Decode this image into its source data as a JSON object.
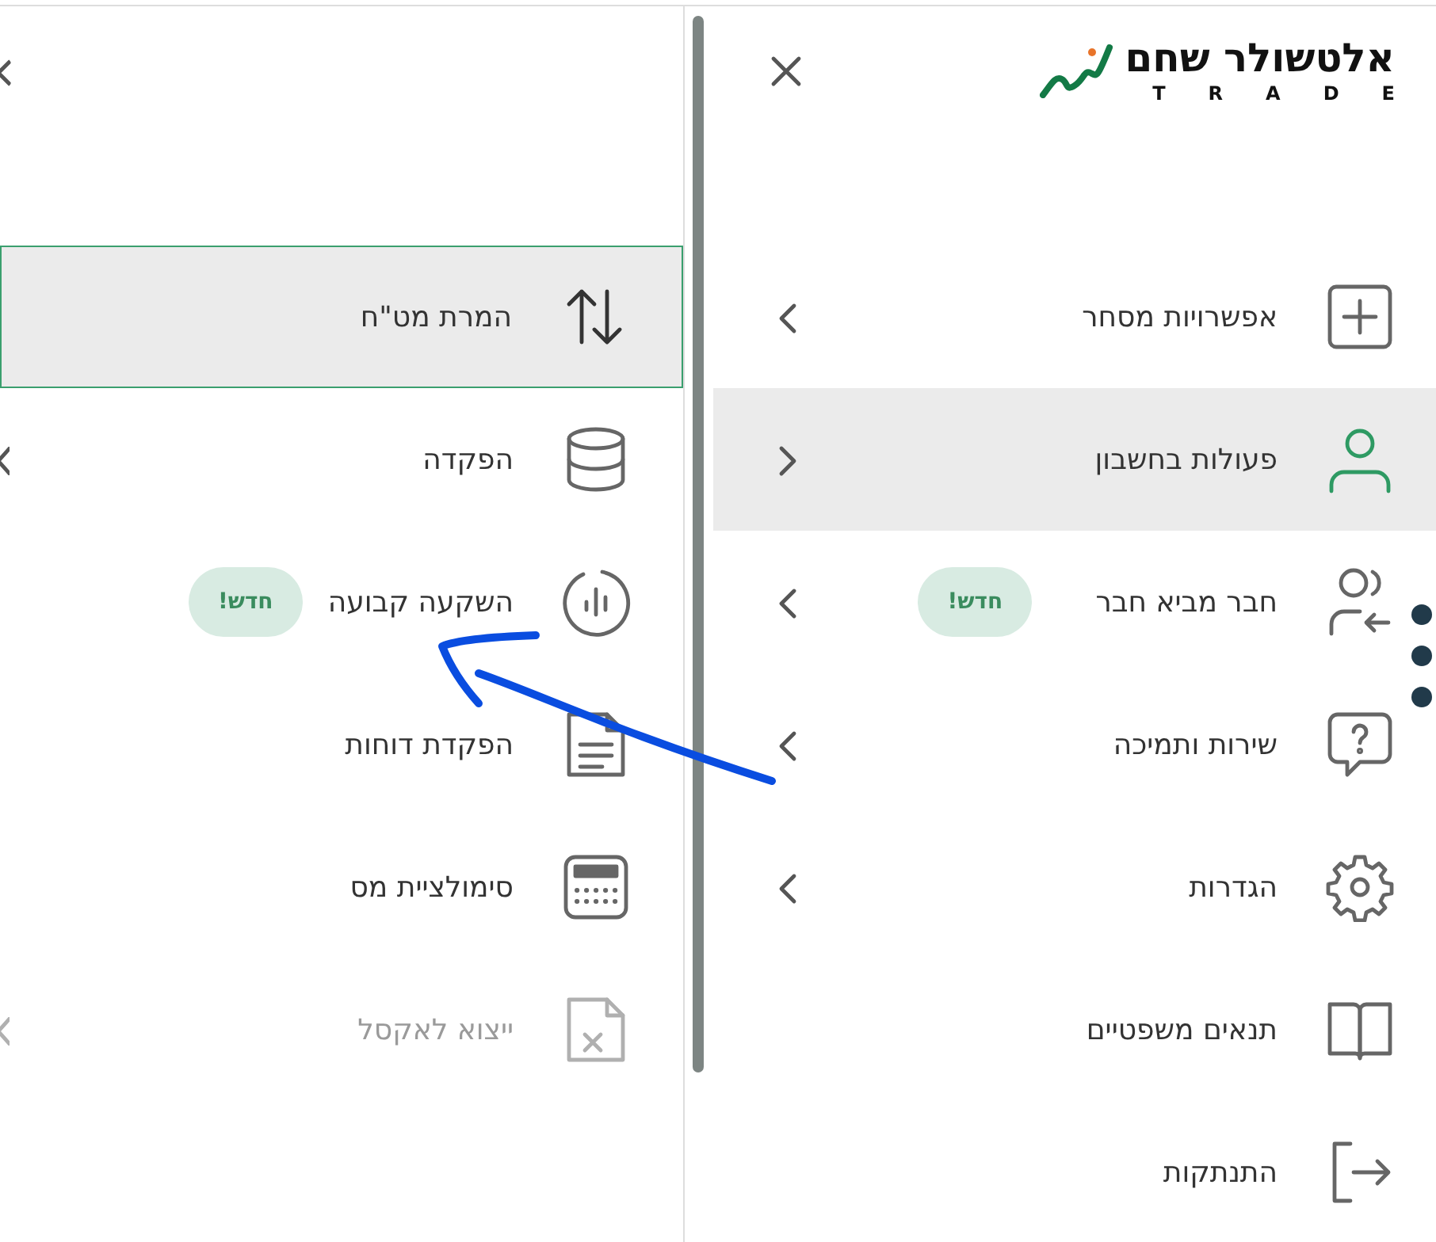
{
  "submenu": {
    "items": [
      {
        "label": "המרת מט\"ח",
        "selected": true,
        "has_submenu": false,
        "disabled": false
      },
      {
        "label": "הפקדה",
        "selected": false,
        "has_submenu": true,
        "disabled": false
      },
      {
        "label": "השקעה קבועה",
        "selected": false,
        "has_submenu": false,
        "disabled": false,
        "badge": "חדש!"
      },
      {
        "label": "הפקדת דוחות",
        "selected": false,
        "has_submenu": false,
        "disabled": false
      },
      {
        "label": "סימולציית מס",
        "selected": false,
        "has_submenu": false,
        "disabled": false
      },
      {
        "label": "ייצוא לאקסל",
        "selected": false,
        "has_submenu": true,
        "disabled": true
      }
    ]
  },
  "logo": {
    "name": "אלטשולר שחם",
    "tagline": "TRADE"
  },
  "main_menu": {
    "items": [
      {
        "label": "אפשרויות מסחר",
        "selected": false,
        "has_submenu": true
      },
      {
        "label": "פעולות בחשבון",
        "selected": true,
        "has_submenu": true
      },
      {
        "label": "חבר מביא חבר",
        "selected": false,
        "has_submenu": true,
        "badge": "חדש!"
      },
      {
        "label": "שירות ותמיכה",
        "selected": false,
        "has_submenu": true
      },
      {
        "label": "הגדרות",
        "selected": false,
        "has_submenu": true
      },
      {
        "label": "תנאים משפטיים",
        "selected": false,
        "has_submenu": false
      },
      {
        "label": "התנתקות",
        "selected": false,
        "has_submenu": false
      }
    ]
  }
}
